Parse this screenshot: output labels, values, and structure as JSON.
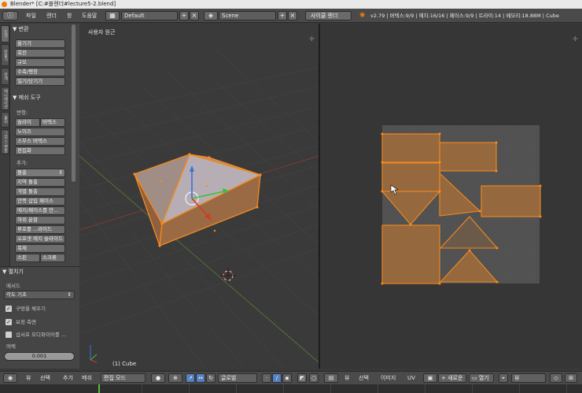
{
  "window": {
    "title": "Blender* [C:#블렌더#lecture5-2.blend]"
  },
  "info_header": {
    "menus": [
      "파일",
      "렌더",
      "창",
      "도움말"
    ],
    "layout": "Default",
    "scene": "Scene",
    "engine": "사이클 렌더",
    "stats": "v2.79 | 버텍스:9/9 | 에지:16/16 | 페이스:9/9 | 트라이:14 | 메모리:18.88M | Cube"
  },
  "tabs": [
    "도구",
    "만들기",
    "관계",
    "애니메이션",
    "물리",
    "그리스 펜슬"
  ],
  "tool_shelf": {
    "transform": {
      "header": "▼ 변환",
      "buttons": [
        "옮기기",
        "회전",
        "규모",
        "수축/팽창",
        "밀기/당기기"
      ]
    },
    "mesh_tools": {
      "header": "▼ 메쉬 도구",
      "deform_label": "변형:",
      "deform_row1": [
        "슬라이",
        "버텍스"
      ],
      "deform_rest": [
        "노이즈",
        "스무스 버텍스",
        "편집화"
      ],
      "add_label": "추가:",
      "extrude": "돌출",
      "add_buttons": [
        "지역 돌출",
        "개별 돌출",
        "안쪽 삽입 페이스",
        "에지/페이스를 만...",
        "하위 분할",
        "루프를 ...라이드",
        "오프셋 에지 슬라이드",
        "복제"
      ],
      "last_row": [
        "스핀",
        "스크류"
      ]
    }
  },
  "operator_panel": {
    "header": "▼ 펼치기",
    "method_label": "메서드",
    "method_value": "각도 기초",
    "fill_holes": "구멍을 채우기",
    "correct_aspect": "보정 측면",
    "use_subsurf": "섭서프 모디파이어를 ...",
    "margin_label": "여백",
    "margin_value": "0.001"
  },
  "viewport_3d": {
    "view_label": "사용자 원근",
    "object_label": "(1) Cube"
  },
  "bottom_header_left": {
    "menus": [
      "뷰",
      "선택",
      "추가",
      "메쉬"
    ],
    "mode": "편집 모드",
    "orientation": "글로벌"
  },
  "bottom_header_right": {
    "menus": [
      "뷰",
      "선택",
      "이미지",
      "UV"
    ],
    "new_label": "새로운",
    "open_label": "열기",
    "view_label": "뷰"
  },
  "colors": {
    "accent": "#e87d0d",
    "face_fill": "#9c6a3c",
    "edge": "#f28a1e",
    "select_blue": "#5680c2"
  }
}
